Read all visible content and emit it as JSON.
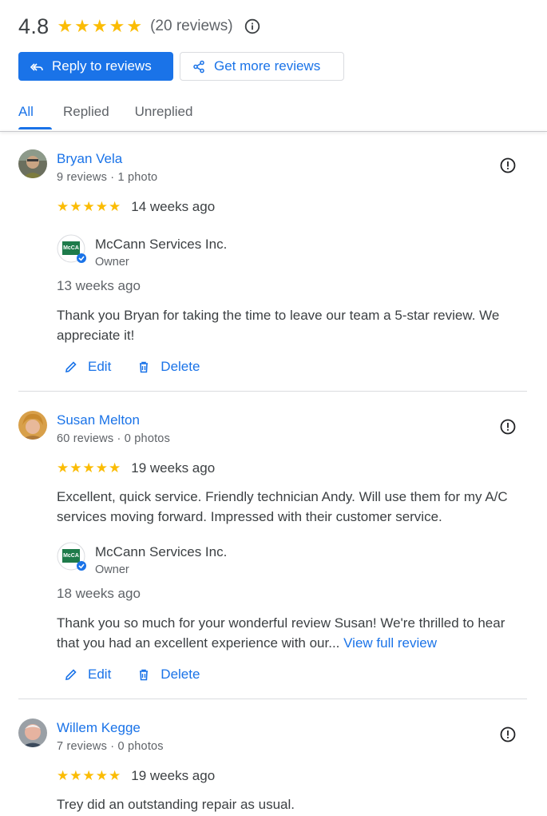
{
  "summary": {
    "rating": "4.8",
    "stars": [
      "★",
      "★",
      "★",
      "★",
      "★"
    ],
    "review_count": "(20 reviews)",
    "info_icon": "info-icon"
  },
  "buttons": {
    "reply_label": "Reply to reviews",
    "more_label": "Get more reviews"
  },
  "tabs": [
    {
      "label": "All",
      "active": true
    },
    {
      "label": "Replied",
      "active": false
    },
    {
      "label": "Unreplied",
      "active": false
    }
  ],
  "colors": {
    "accent": "#1a73e8",
    "star": "#fbbc04",
    "text": "#3c4043",
    "muted": "#5f6368",
    "divider": "#dadce0"
  },
  "reviews": [
    {
      "name": "Bryan Vela",
      "meta": "9 reviews · 1 photo",
      "rating": 5,
      "when": "14 weeks ago",
      "reply": {
        "business": "McCann Services Inc.",
        "role": "Owner",
        "when": "13 weeks ago",
        "text": "Thank you Bryan for taking the time to leave our team a 5-star review. We appreciate it!"
      },
      "edit_label": "Edit",
      "delete_label": "Delete"
    },
    {
      "name": "Susan Melton",
      "meta": "60 reviews · 0 photos",
      "rating": 5,
      "when": "19 weeks ago",
      "text": "Excellent, quick service. Friendly technician Andy. Will use them for my A/C services moving forward. Impressed with their customer service.",
      "reply": {
        "business": "McCann Services Inc.",
        "role": "Owner",
        "when": "18 weeks ago",
        "text": "Thank you so much for your wonderful review Susan! We're thrilled to hear that you had an excellent experience with our...",
        "more_link": "View full review"
      },
      "edit_label": "Edit",
      "delete_label": "Delete"
    },
    {
      "name": "Willem Kegge",
      "meta": "7 reviews · 0 photos",
      "rating": 5,
      "when": "19 weeks ago",
      "text": "Trey did an outstanding repair as usual."
    }
  ]
}
